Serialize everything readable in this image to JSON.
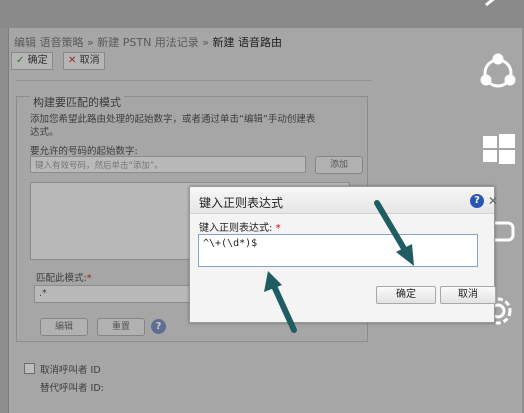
{
  "breadcrumb": {
    "items": [
      "编辑 语音策略",
      "新建 PSTN 用法记录"
    ],
    "separator": "»",
    "current": "新建 语音路由"
  },
  "toolbar": {
    "ok_label": "确定",
    "cancel_label": "取消"
  },
  "section": {
    "title": "构建要匹配的模式",
    "description_line1": "添加您希望此路由处理的起始数字，或者通过单击“编辑”手动创建表",
    "description_line2": "达式。",
    "allowed_numbers_label": "要允许的号码的起始数字:",
    "number_input_placeholder": "键入有效号码，然后单击“添加”。",
    "add_button": "添加",
    "match_pattern_label": "匹配此模式:",
    "match_pattern_value": ".*",
    "edit_button": "编辑",
    "reset_button": "重置"
  },
  "suppress_caller_id": {
    "label": "取消呼叫者 ID",
    "checked": false
  },
  "alternate_caller_id_label": "替代呼叫者 ID:",
  "dialog": {
    "title": "键入正则表达式",
    "expression_label": "键入正则表达式:",
    "required_mark": "*",
    "expression_value": "^\\+(\\d*)$",
    "ok_button": "确定",
    "cancel_button": "取消"
  },
  "colors": {
    "accent": "#2857b8",
    "arrow": "#1f5d63",
    "required": "#dd0000"
  },
  "icons": [
    "check-icon",
    "cross-icon",
    "help-icon",
    "close-icon",
    "sync-circle-icon",
    "windows-logo-icon",
    "remote-desktop-icon",
    "gear-icon",
    "arrow-annotation"
  ]
}
